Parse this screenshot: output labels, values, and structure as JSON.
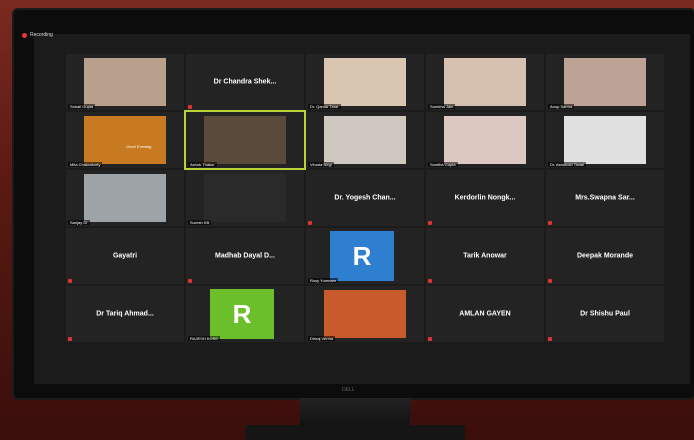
{
  "meeting": {
    "recording_label": "Recording"
  },
  "tiles": [
    {
      "id": "sohail",
      "type": "video",
      "label": "Sohail Gupta",
      "bg": "#b7a08c"
    },
    {
      "id": "chandra",
      "type": "name",
      "name": "Dr Chandra Shek..."
    },
    {
      "id": "qamar",
      "type": "video",
      "label": "Dr. Qamar Tarar",
      "bg": "#d8c6b2"
    },
    {
      "id": "surekha",
      "type": "video",
      "label": "Surekha Jain",
      "bg": "#d6c0b0"
    },
    {
      "id": "anup",
      "type": "video",
      "label": "Anup Sarma",
      "bg": "#bda396"
    },
    {
      "id": "mita",
      "type": "video",
      "label": "Mita Chakraborty",
      "bg": "#c77a20",
      "caption": "Good Evening"
    },
    {
      "id": "ashok",
      "type": "video",
      "label": "Ashok Thakur",
      "bg": "#5a4a3a",
      "active": true
    },
    {
      "id": "vinod",
      "type": "video",
      "label": "Vinoda Negi",
      "bg": "#cfc8c0"
    },
    {
      "id": "sunitha",
      "type": "video",
      "label": "Sunitha Gupta",
      "bg": "#dcc8c0"
    },
    {
      "id": "ashutosh",
      "type": "video",
      "label": "Dr. Ashutosh Tiwari",
      "bg": "#e0e0e0"
    },
    {
      "id": "sanjay",
      "type": "video",
      "label": "Sanjay Dr",
      "bg": "#9ea3a8"
    },
    {
      "id": "suresh",
      "type": "video",
      "label": "Suresh KB",
      "bg": "#2a2a2a"
    },
    {
      "id": "yogesh",
      "type": "name",
      "name": "Dr. Yogesh Chan..."
    },
    {
      "id": "kerdorlin",
      "type": "name",
      "name": "Kerdorlin Nongk..."
    },
    {
      "id": "swapna",
      "type": "name",
      "name": "Mrs.Swapna Sar..."
    },
    {
      "id": "gayatri",
      "type": "name",
      "name": "Gayatri"
    },
    {
      "id": "madhab",
      "type": "name",
      "name": "Madhab Dayal D..."
    },
    {
      "id": "rosy",
      "type": "avatar",
      "letter": "R",
      "color": "#2f7fd0",
      "label": "Rosy Yumnam"
    },
    {
      "id": "tarik",
      "type": "name",
      "name": "Tarik Anowar"
    },
    {
      "id": "deepak",
      "type": "name",
      "name": "Deepak Morande"
    },
    {
      "id": "tariq",
      "type": "name",
      "name": "Dr Tariq Ahmad..."
    },
    {
      "id": "rajesh",
      "type": "avatar",
      "letter": "R",
      "color": "#6abf2a",
      "label": "RAJESH KOSE"
    },
    {
      "id": "dhiraj",
      "type": "video",
      "label": "Dhiraj Verma",
      "bg": "#c85a2c"
    },
    {
      "id": "amlan",
      "type": "name",
      "name": "AMLAN GAYEN"
    },
    {
      "id": "shishu",
      "type": "name",
      "name": "Dr Shishu Paul"
    }
  ],
  "monitor_brand": "DELL"
}
